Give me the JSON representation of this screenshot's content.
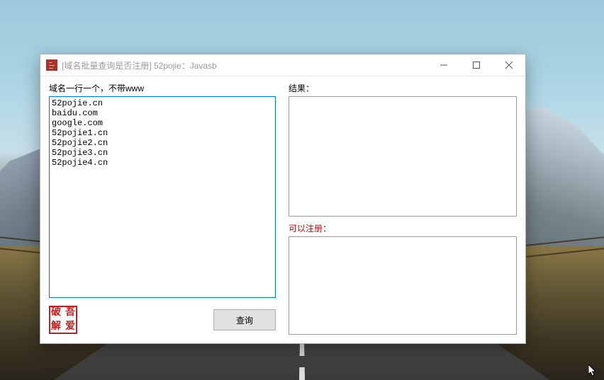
{
  "window": {
    "title": "[域名批量查询是否注册] 52pojie：Javasb"
  },
  "left": {
    "label": "域名一行一个，不带www",
    "value": "52pojie.cn\nbaidu.com\ngoogle.com\n52pojie1.cn\n52pojie2.cn\n52pojie3.cn\n52pojie4.cn"
  },
  "right": {
    "result_label": "结果：",
    "result_value": "",
    "available_label": "可以注册：",
    "available_value": ""
  },
  "buttons": {
    "query": "查询"
  },
  "seal": {
    "tl": "破",
    "tr": "吾",
    "bl": "解",
    "br": "爱"
  }
}
